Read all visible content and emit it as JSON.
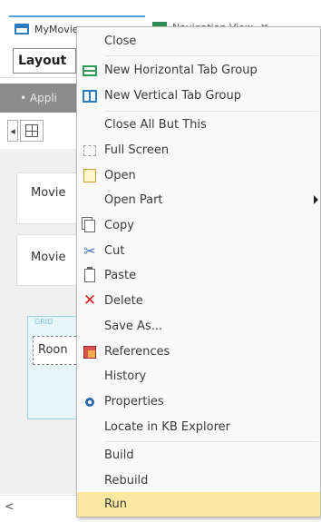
{
  "tabs": [
    {
      "label": "MyMovies",
      "close": "✕"
    },
    {
      "label": "Navigation View",
      "close": "✕"
    }
  ],
  "toolbar": {
    "layout_label": "Layout"
  },
  "app_bar": {
    "text": "• Appli"
  },
  "tools": {
    "left_arrow": "◂"
  },
  "form": {
    "rows": [
      {
        "label": "Movie"
      },
      {
        "label": "Movie"
      }
    ],
    "grid": {
      "tag": "GRID",
      "row_label": "Roon"
    }
  },
  "scroll": {
    "left_arrow": "<"
  },
  "context_menu": {
    "items": [
      {
        "label": "Close",
        "icon": "none"
      },
      {
        "label": "New Horizontal Tab Group",
        "icon": "horizontal-tab-group-icon"
      },
      {
        "label": "New Vertical Tab Group",
        "icon": "vertical-tab-group-icon"
      },
      {
        "label": "Close All But This",
        "icon": "none"
      },
      {
        "label": "Full Screen",
        "icon": "full-screen-icon"
      },
      {
        "label": "Open",
        "icon": "open-icon"
      },
      {
        "label": "Open Part",
        "icon": "none",
        "has_submenu": true
      },
      {
        "label": "Copy",
        "icon": "copy-icon"
      },
      {
        "label": "Cut",
        "icon": "cut-icon"
      },
      {
        "label": "Paste",
        "icon": "paste-icon"
      },
      {
        "label": "Delete",
        "icon": "delete-icon"
      },
      {
        "label": "Save As...",
        "icon": "none"
      },
      {
        "label": "References",
        "icon": "references-icon"
      },
      {
        "label": "History",
        "icon": "none"
      },
      {
        "label": "Properties",
        "icon": "properties-icon"
      },
      {
        "label": "Locate in KB Explorer",
        "icon": "none"
      },
      {
        "label": "Build",
        "icon": "none"
      },
      {
        "label": "Rebuild",
        "icon": "none"
      },
      {
        "label": "Run",
        "icon": "none",
        "highlighted": true
      }
    ]
  },
  "colors": {
    "highlight": "#fde9a2",
    "app_bar": "#8c8c8c",
    "accent_blue": "#2b7bbf",
    "accent_green": "#2e9b57",
    "delete_red": "#e02020"
  }
}
